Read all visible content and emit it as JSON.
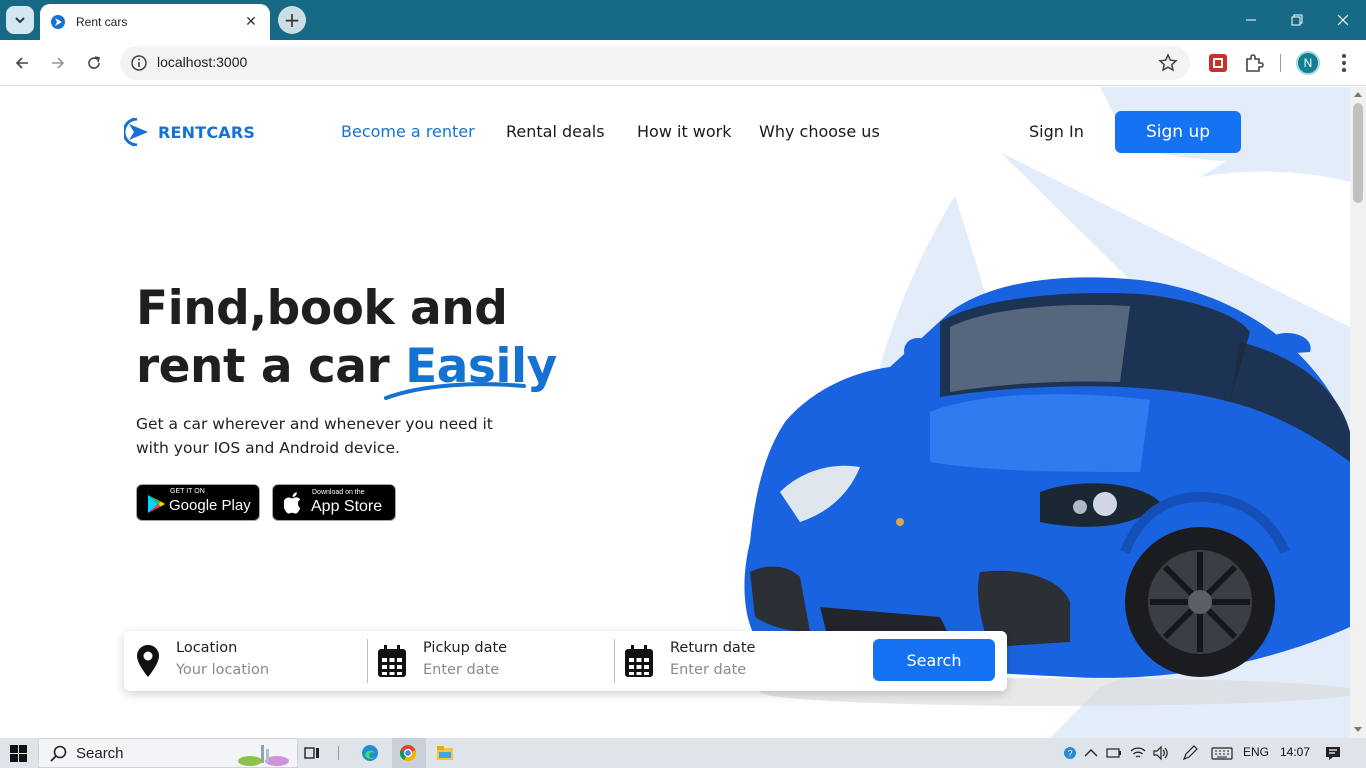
{
  "browser": {
    "tab_title": "Rent cars",
    "url": "localhost:3000",
    "profile_initial": "N"
  },
  "site": {
    "brand": "RENTCARS",
    "nav": [
      "Become a renter",
      "Rental deals",
      "How it work",
      "Why choose us"
    ],
    "sign_in": "Sign In",
    "sign_up": "Sign up",
    "hero": {
      "title_line1": "Find,book and",
      "title_line2_prefix": "rent a car",
      "title_accent": "Easily",
      "subtitle": "Get a car wherever and whenever you need it with your IOS and Android device."
    },
    "stores": {
      "google_small": "GET IT ON",
      "google_big": "Google Play",
      "apple_small": "Download on the",
      "apple_big": "App Store"
    },
    "search": {
      "location_label": "Location",
      "location_placeholder": "Your location",
      "pickup_label": "Pickup date",
      "pickup_placeholder": "Enter date",
      "return_label": "Return date",
      "return_placeholder": "Enter date",
      "button": "Search"
    },
    "colors": {
      "primary": "#1572D3",
      "button": "#1572F3",
      "shape": "#E3EDF9"
    }
  },
  "taskbar": {
    "search_label": "Search",
    "language": "ENG",
    "time": "14:07"
  }
}
